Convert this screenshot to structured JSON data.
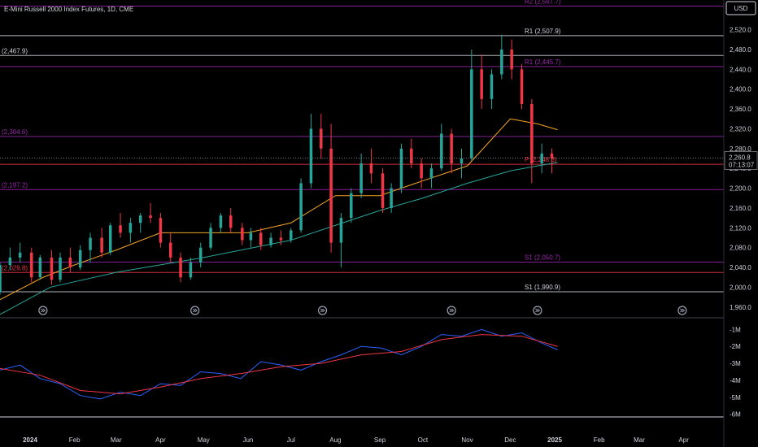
{
  "header": {
    "title": "E-Mini Russell 2000 Index Futures, 1D, CME",
    "currency_button": "USD"
  },
  "chart_data": [
    {
      "type": "candlestick",
      "title": "E-Mini Russell 2000 Index Futures, 1D, CME",
      "y_range": [
        1940,
        2580
      ],
      "y_ticks": [
        "2,520.0",
        "2,480.0",
        "2,440.0",
        "2,400.0",
        "2,360.0",
        "2,320.0",
        "2,280.0",
        "2,240.0",
        "2,200.0",
        "2,160.0",
        "2,120.0",
        "2,080.0",
        "2,040.0",
        "2,000.0",
        "1,960.0"
      ],
      "x_range": [
        "2023-12-11",
        "2025-04-29"
      ],
      "x_ticks": [
        {
          "date": "2024-01-01",
          "label": "2024"
        },
        {
          "date": "2024-02-01",
          "label": "Feb"
        },
        {
          "date": "2024-03-01",
          "label": "Mar"
        },
        {
          "date": "2024-04-01",
          "label": "Apr"
        },
        {
          "date": "2024-05-01",
          "label": "May"
        },
        {
          "date": "2024-06-01",
          "label": "Jun"
        },
        {
          "date": "2024-07-01",
          "label": "Jul"
        },
        {
          "date": "2024-08-01",
          "label": "Aug"
        },
        {
          "date": "2024-09-01",
          "label": "Sep"
        },
        {
          "date": "2024-10-01",
          "label": "Oct"
        },
        {
          "date": "2024-11-01",
          "label": "Nov"
        },
        {
          "date": "2024-12-01",
          "label": "Dec"
        },
        {
          "date": "2025-01-01",
          "label": "2025"
        },
        {
          "date": "2025-02-01",
          "label": "Feb"
        },
        {
          "date": "2025-03-01",
          "label": "Mar"
        },
        {
          "date": "2025-04-01",
          "label": "Apr"
        }
      ],
      "current_price": {
        "value": 2260.8,
        "label": "2,260.8",
        "countdown": "07:13:07"
      },
      "horizontal_levels": [
        {
          "label": "R2 (2,567.7)",
          "value": 2567.7,
          "color": "#9c27b0"
        },
        {
          "label": "R1 (2,507.9)",
          "value": 2507.9,
          "color": "#d1d4dc"
        },
        {
          "label": "(2,467.9)",
          "value": 2467.9,
          "color": "#d1d4dc"
        },
        {
          "label": "R1 (2,445.7)",
          "value": 2445.7,
          "color": "#9c27b0"
        },
        {
          "label": "(2,304.6)",
          "value": 2304.6,
          "color": "#9c27b0"
        },
        {
          "label": "P (2,248.3)",
          "value": 2248.3,
          "color": "#f23645"
        },
        {
          "label": "(2,197.2)",
          "value": 2197.2,
          "color": "#9c27b0"
        },
        {
          "label": "S1 (2,050.7)",
          "value": 2050.7,
          "color": "#9c27b0"
        },
        {
          "label": "(2,029.8)",
          "value": 2029.8,
          "color": "#f23645"
        },
        {
          "label": "S1 (1,990.9)",
          "value": 1990.9,
          "color": "#d1d4dc"
        }
      ],
      "moving_averages": [
        {
          "color": "#f5a623",
          "points": [
            [
              "2023-12-11",
              1975
            ],
            [
              "2024-01-10",
              2020
            ],
            [
              "2024-02-01",
              2045
            ],
            [
              "2024-03-01",
              2075
            ],
            [
              "2024-04-01",
              2110
            ],
            [
              "2024-05-01",
              2110
            ],
            [
              "2024-06-01",
              2110
            ],
            [
              "2024-07-01",
              2130
            ],
            [
              "2024-08-01",
              2185
            ],
            [
              "2024-09-01",
              2185
            ],
            [
              "2024-10-01",
              2215
            ],
            [
              "2024-11-01",
              2245
            ],
            [
              "2024-12-01",
              2340
            ],
            [
              "2024-12-20",
              2330
            ],
            [
              "2025-01-03",
              2318
            ]
          ]
        },
        {
          "color": "#26a69a",
          "points": [
            [
              "2023-12-11",
              1945
            ],
            [
              "2024-01-15",
              2000
            ],
            [
              "2024-03-01",
              2030
            ],
            [
              "2024-05-01",
              2060
            ],
            [
              "2024-07-01",
              2095
            ],
            [
              "2024-08-01",
              2125
            ],
            [
              "2024-09-01",
              2155
            ],
            [
              "2024-10-01",
              2180
            ],
            [
              "2024-11-01",
              2210
            ],
            [
              "2024-12-01",
              2235
            ],
            [
              "2024-12-20",
              2245
            ],
            [
              "2025-01-03",
              2252
            ]
          ]
        }
      ],
      "event_markers": [
        "2024-01-10",
        "2024-04-25",
        "2024-07-23",
        "2024-10-21",
        "2024-12-20",
        "2025-03-31"
      ],
      "candles": [
        [
          "2023-12-11",
          1990,
          2050,
          1985,
          2045
        ],
        [
          "2023-12-18",
          2045,
          2080,
          2035,
          2060
        ],
        [
          "2023-12-25",
          2060,
          2090,
          2050,
          2070
        ],
        [
          "2024-01-02",
          2070,
          2080,
          2010,
          2020
        ],
        [
          "2024-01-08",
          2020,
          2065,
          2015,
          2060
        ],
        [
          "2024-01-16",
          2060,
          2075,
          2005,
          2015
        ],
        [
          "2024-01-22",
          2015,
          2070,
          2010,
          2060
        ],
        [
          "2024-01-29",
          2060,
          2080,
          2030,
          2040
        ],
        [
          "2024-02-05",
          2040,
          2085,
          2035,
          2075
        ],
        [
          "2024-02-12",
          2075,
          2110,
          2050,
          2100
        ],
        [
          "2024-02-20",
          2100,
          2120,
          2060,
          2070
        ],
        [
          "2024-02-26",
          2070,
          2130,
          2065,
          2125
        ],
        [
          "2024-03-04",
          2125,
          2150,
          2100,
          2110
        ],
        [
          "2024-03-11",
          2110,
          2140,
          2090,
          2130
        ],
        [
          "2024-03-18",
          2130,
          2150,
          2110,
          2145
        ],
        [
          "2024-03-25",
          2145,
          2170,
          2130,
          2140
        ],
        [
          "2024-04-01",
          2140,
          2150,
          2080,
          2090
        ],
        [
          "2024-04-08",
          2090,
          2110,
          2050,
          2060
        ],
        [
          "2024-04-15",
          2060,
          2070,
          2010,
          2020
        ],
        [
          "2024-04-22",
          2020,
          2060,
          2015,
          2050
        ],
        [
          "2024-04-29",
          2050,
          2090,
          2040,
          2080
        ],
        [
          "2024-05-06",
          2080,
          2130,
          2075,
          2120
        ],
        [
          "2024-05-13",
          2120,
          2150,
          2110,
          2145
        ],
        [
          "2024-05-20",
          2145,
          2160,
          2110,
          2120
        ],
        [
          "2024-05-28",
          2120,
          2130,
          2085,
          2095
        ],
        [
          "2024-06-03",
          2095,
          2120,
          2080,
          2110
        ],
        [
          "2024-06-10",
          2110,
          2120,
          2075,
          2085
        ],
        [
          "2024-06-17",
          2085,
          2110,
          2080,
          2100
        ],
        [
          "2024-06-24",
          2100,
          2115,
          2085,
          2095
        ],
        [
          "2024-07-01",
          2095,
          2120,
          2090,
          2115
        ],
        [
          "2024-07-08",
          2115,
          2220,
          2110,
          2210
        ],
        [
          "2024-07-15",
          2210,
          2350,
          2200,
          2320
        ],
        [
          "2024-07-22",
          2320,
          2350,
          2260,
          2280
        ],
        [
          "2024-07-29",
          2280,
          2330,
          2070,
          2090
        ],
        [
          "2024-08-05",
          2090,
          2150,
          2040,
          2140
        ],
        [
          "2024-08-12",
          2140,
          2200,
          2130,
          2190
        ],
        [
          "2024-08-19",
          2190,
          2270,
          2180,
          2250
        ],
        [
          "2024-08-26",
          2250,
          2280,
          2210,
          2230
        ],
        [
          "2024-09-03",
          2230,
          2240,
          2150,
          2160
        ],
        [
          "2024-09-09",
          2160,
          2210,
          2150,
          2200
        ],
        [
          "2024-09-16",
          2200,
          2290,
          2190,
          2280
        ],
        [
          "2024-09-23",
          2280,
          2300,
          2240,
          2250
        ],
        [
          "2024-09-30",
          2250,
          2260,
          2200,
          2220
        ],
        [
          "2024-10-07",
          2220,
          2250,
          2200,
          2240
        ],
        [
          "2024-10-14",
          2240,
          2330,
          2235,
          2310
        ],
        [
          "2024-10-21",
          2310,
          2320,
          2230,
          2250
        ],
        [
          "2024-10-28",
          2250,
          2280,
          2220,
          2260
        ],
        [
          "2024-11-04",
          2260,
          2480,
          2255,
          2440
        ],
        [
          "2024-11-11",
          2440,
          2470,
          2360,
          2380
        ],
        [
          "2024-11-18",
          2380,
          2440,
          2360,
          2430
        ],
        [
          "2024-11-25",
          2430,
          2510,
          2420,
          2480
        ],
        [
          "2024-12-02",
          2480,
          2500,
          2420,
          2440
        ],
        [
          "2024-12-09",
          2440,
          2450,
          2360,
          2370
        ],
        [
          "2024-12-16",
          2370,
          2380,
          2210,
          2250
        ],
        [
          "2024-12-23",
          2250,
          2290,
          2230,
          2270
        ],
        [
          "2024-12-30",
          2270,
          2280,
          2230,
          2260
        ]
      ]
    },
    {
      "type": "line",
      "y_range": [
        -6.4,
        -0.6
      ],
      "y_ticks": [
        "-1M",
        "-2M",
        "-3M",
        "-4M",
        "-5M",
        "-6M"
      ],
      "x_range": [
        "2023-12-11",
        "2025-04-29"
      ],
      "series": [
        {
          "color": "#2962ff",
          "points": [
            [
              "2023-12-11",
              -3.4
            ],
            [
              "2023-12-25",
              -3.1
            ],
            [
              "2024-01-08",
              -3.9
            ],
            [
              "2024-01-22",
              -4.2
            ],
            [
              "2024-02-05",
              -4.9
            ],
            [
              "2024-02-19",
              -5.1
            ],
            [
              "2024-03-04",
              -4.7
            ],
            [
              "2024-03-18",
              -4.9
            ],
            [
              "2024-04-01",
              -4.2
            ],
            [
              "2024-04-15",
              -4.3
            ],
            [
              "2024-04-29",
              -3.5
            ],
            [
              "2024-05-13",
              -3.6
            ],
            [
              "2024-05-27",
              -3.9
            ],
            [
              "2024-06-10",
              -2.9
            ],
            [
              "2024-06-24",
              -3.1
            ],
            [
              "2024-07-08",
              -3.4
            ],
            [
              "2024-07-22",
              -2.9
            ],
            [
              "2024-08-05",
              -2.5
            ],
            [
              "2024-08-19",
              -2.0
            ],
            [
              "2024-09-02",
              -2.1
            ],
            [
              "2024-09-16",
              -2.5
            ],
            [
              "2024-09-30",
              -2.0
            ],
            [
              "2024-10-14",
              -1.3
            ],
            [
              "2024-10-28",
              -1.4
            ],
            [
              "2024-11-11",
              -1.0
            ],
            [
              "2024-11-25",
              -1.4
            ],
            [
              "2024-12-09",
              -1.2
            ],
            [
              "2024-12-23",
              -1.8
            ],
            [
              "2025-01-03",
              -2.2
            ]
          ]
        },
        {
          "color": "#f23645",
          "points": [
            [
              "2023-12-11",
              -3.3
            ],
            [
              "2024-01-08",
              -3.7
            ],
            [
              "2024-02-05",
              -4.6
            ],
            [
              "2024-03-04",
              -4.8
            ],
            [
              "2024-04-01",
              -4.4
            ],
            [
              "2024-04-29",
              -3.9
            ],
            [
              "2024-05-27",
              -3.6
            ],
            [
              "2024-06-24",
              -3.2
            ],
            [
              "2024-07-22",
              -3.0
            ],
            [
              "2024-08-19",
              -2.5
            ],
            [
              "2024-09-16",
              -2.3
            ],
            [
              "2024-10-14",
              -1.6
            ],
            [
              "2024-11-11",
              -1.3
            ],
            [
              "2024-12-09",
              -1.4
            ],
            [
              "2025-01-03",
              -2.0
            ]
          ]
        }
      ]
    }
  ]
}
